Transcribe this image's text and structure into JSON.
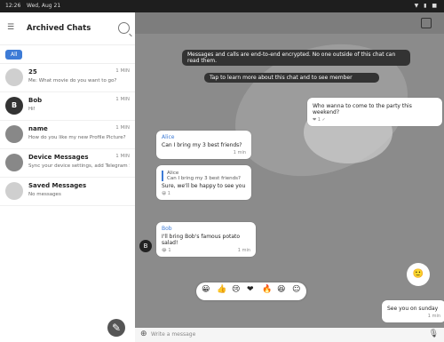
{
  "status": {
    "time": "12:26",
    "date": "Wed, Aug 21",
    "icons": "▼ ▮ ■"
  },
  "left": {
    "title": "Archived Chats",
    "tab": "All",
    "chats": [
      {
        "avatar": "",
        "name": "25",
        "msg": "Me: What movie do you want to go?",
        "time": "1 MIN"
      },
      {
        "avatar": "B",
        "name": "Bob",
        "msg": "Hi!",
        "time": "1 MIN"
      },
      {
        "avatar": "",
        "name": "name",
        "msg": "How do you like my new Profile Picture?",
        "time": "1 MIN"
      },
      {
        "avatar": "",
        "name": "Device Messages",
        "msg": "Sync your device settings, add Telegram Stickers",
        "time": "1 MIN"
      },
      {
        "avatar": "",
        "name": "Saved Messages",
        "msg": "No messages",
        "time": ""
      }
    ],
    "fab": "✎"
  },
  "chat": {
    "banner1": "Messages and calls are end-to-end encrypted. No one outside of this chat can read them.",
    "banner2": "Tap to learn more about this chat and to see member",
    "msg_out1": "Who wanna to come to the party this weekend?",
    "msg_out1_reacts": "❤ 1 ✓",
    "msg_alice_sender": "Alice",
    "msg_alice_text": "Can I bring my 3 best friends?",
    "msg_alice_time": "1 min",
    "reply_to": "Alice",
    "reply_text": "Can I bring my 3 best friends?",
    "reply_msg": "Sure, we'll be happy to see you",
    "reply_reactions": "😀 1",
    "bob_avatar": "B",
    "bob_sender": "Bob",
    "bob_text": "I'll bring Bob's famous potato salad!",
    "bob_time": "1 min",
    "bob_reacts": "😂 1",
    "reactions": [
      "😀",
      "👍",
      "😢",
      "❤",
      "🔥",
      "😆",
      "☺"
    ],
    "emoji_big": "🙂",
    "out_last": "See you on sunday",
    "out_last_time": "1 min",
    "scroll_icon": "⌄",
    "input_placeholder": "Write a message",
    "attach_icon": "⊕",
    "mic_icon": "🎙"
  }
}
